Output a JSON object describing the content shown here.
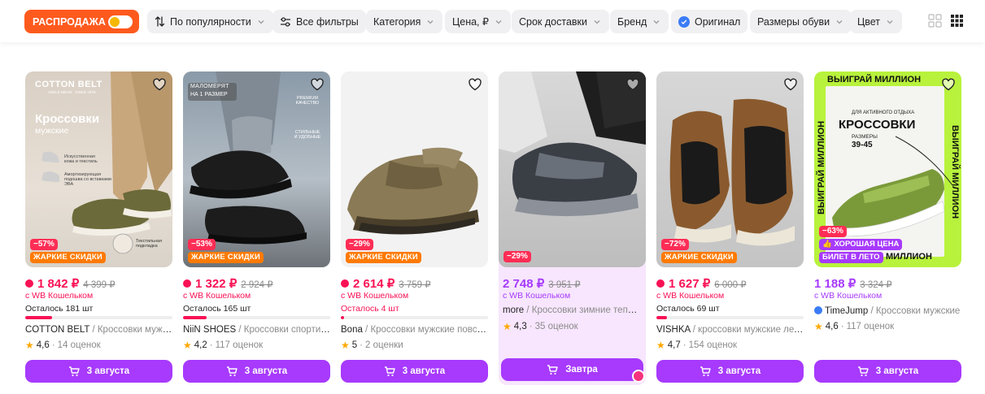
{
  "filters": {
    "sale": "РАСПРОДАЖА",
    "sort": "По популярности",
    "all": "Все фильтры",
    "category": "Категория",
    "price": "Цена, ₽",
    "delivery": "Срок доставки",
    "brand": "Бренд",
    "original": "Оригинал",
    "size": "Размеры обуви",
    "color": "Цвет"
  },
  "colors": {
    "accent": "#a73afd",
    "sale": "#f91155",
    "saleTag": "#ff5a1e",
    "hot": "#ff7a00"
  },
  "products": [
    {
      "discount": "−57%",
      "tag": "ЖАРКИЕ СКИДКИ",
      "price": "1 842 ₽",
      "old": "4 399 ₽",
      "wallet": "с WB Кошельком",
      "stock": "Осталось 181 шт",
      "stock_level": 0.18,
      "brand": "COTTON BELT",
      "name": "Кроссовки мужские",
      "rating": "4,6",
      "reviews": "14 оценок",
      "delivery": "3 августа",
      "img": {
        "brand": "COTTON BELT",
        "sub": "ANKLE WEAR · SINCE 1978",
        "title": "Кроссовки",
        "subtitle": "мужские",
        "f1": "Искусственная кожа и текстиль",
        "f2": "Амортизирующая подошва со вставками ЭВА",
        "f3": "Текстильная подкладка"
      }
    },
    {
      "discount": "−53%",
      "tag": "ЖАРКИЕ СКИДКИ",
      "price": "1 322 ₽",
      "old": "2 924 ₽",
      "wallet": "с WB Кошельком",
      "stock": "Осталось 165 шт",
      "stock_level": 0.16,
      "brand": "NiiN SHOES",
      "name": "Кроссовки спортивные",
      "rating": "4,2",
      "reviews": "117 оценок",
      "delivery": "3 августа",
      "img": {
        "l1": "МАЛОМЕРЯТ",
        "l2": "НА 1 РАЗМЕР",
        "f1": "PREMIUM КАЧЕСТВО",
        "f2": "СТИЛЬНЫЕ И УДОБНЫЕ"
      }
    },
    {
      "discount": "−29%",
      "tag": "ЖАРКИЕ СКИДКИ",
      "price": "2 614 ₽",
      "old": "3 759 ₽",
      "wallet": "с WB Кошельком",
      "stock": "Осталось 4 шт",
      "stock_level": 0.02,
      "brand": "Bona",
      "name": "Кроссовки мужские повседневные",
      "rating": "5",
      "reviews": "2 оценки",
      "delivery": "3 августа"
    },
    {
      "discount": "−29%",
      "price": "2 748 ₽",
      "old": "3 951 ₽",
      "wallet": "с WB Кошельком",
      "brand": "more",
      "name": "Кроссовки зимние теплые",
      "rating": "4,3",
      "reviews": "35 оценок",
      "delivery": "Завтра"
    },
    {
      "discount": "−72%",
      "tag": "ЖАРКИЕ СКИДКИ",
      "price": "1 627 ₽",
      "old": "6 000 ₽",
      "wallet": "с WB Кошельком",
      "stock": "Осталось 69 шт",
      "stock_level": 0.07,
      "brand": "VISHKA",
      "name": "кроссовки мужские летние",
      "rating": "4,7",
      "reviews": "154 оценок",
      "delivery": "3 августа"
    },
    {
      "discount": "−63%",
      "tag": "ХОРОШАЯ ЦЕНА",
      "tag2": "БИЛЕТ В ЛЕТО",
      "price": "1 188 ₽",
      "old": "3 324 ₽",
      "wallet": "с WB Кошельком",
      "brand": "TimeJump",
      "name": "Кроссовки мужские",
      "rating": "4,6",
      "reviews": "117 оценок",
      "delivery": "3 августа",
      "img": {
        "top": "ВЫИГРАЙ МИЛЛИОН",
        "side": "ВЫИГРАЙ МИЛЛИОН",
        "bottom": "МИЛЛИОН",
        "l1": "ДЛЯ АКТИВНОГО ОТДЫХА",
        "title": "КРОССОВКИ",
        "l2": "РАЗМЕРЫ",
        "l3": "39-45"
      }
    }
  ]
}
